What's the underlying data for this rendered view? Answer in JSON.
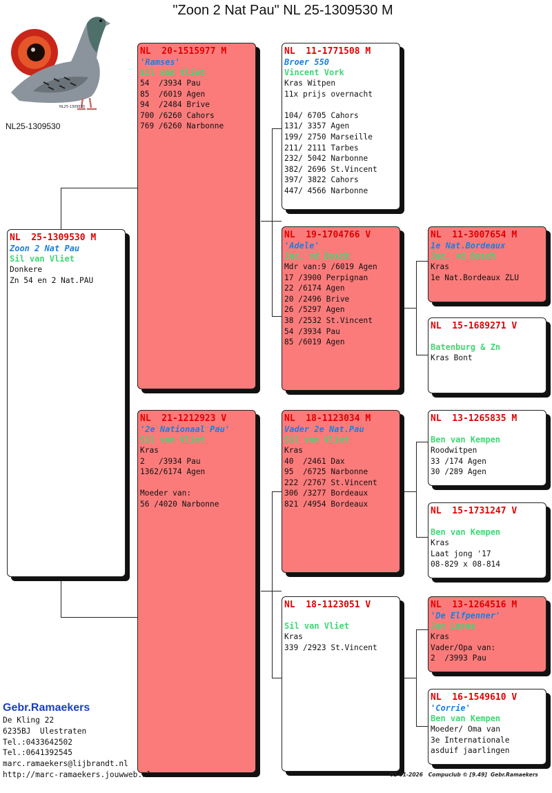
{
  "title": "\"Zoon 2 Nat Pau\"  NL  25-1309530 M",
  "photo": {
    "caption": "NL25-1309530",
    "ring_small": "NL25-1309530"
  },
  "subject": {
    "ring": "NL  25-1309530 M",
    "name": "Zoon 2 Nat Pau",
    "breeder": "Sil van Vliet",
    "lines": [
      "Donkere",
      "Zn 54 en 2 Nat.PAU"
    ]
  },
  "father": {
    "ring": "NL  20-1515977 M",
    "name": "'Ramses'",
    "breeder": "Sil van Vliet",
    "lines": [
      "54  /3934 Pau",
      "85  /6019 Agen",
      "94  /2484 Brive",
      "700 /6260 Cahors",
      "769 /6260 Narbonne"
    ]
  },
  "mother": {
    "ring": "NL  21-1212923 V",
    "name": "'2e Nationaal Pau'",
    "breeder": "Sil van Vliet",
    "lines": [
      "Kras",
      "2   /3934 Pau",
      "1362/6174 Agen",
      "",
      "Moeder van:",
      "56 /4020 Narbonne"
    ]
  },
  "ff": {
    "ring": "NL  11-1771508 M",
    "name": "Broer 550",
    "breeder": "Vincent Vork",
    "lines": [
      "Kras Witpen",
      "11x prijs overnacht",
      "",
      "104/ 6705 Cahors",
      "131/ 3357 Agen",
      "199/ 2750 Marseille",
      "211/ 2111 Tarbes",
      "232/ 5042 Narbonne",
      "382/ 2696 St.Vincent",
      "397/ 3822 Cahors",
      "447/ 4566 Narbonne"
    ]
  },
  "fm": {
    "ring": "NL  19-1704766 V",
    "name": "'Adele'",
    "breeder": "Jac. vd Bosch",
    "lines": [
      "Mdr van:9 /6019 Agen",
      "17 /3900 Perpignan",
      "22 /6174 Agen",
      "20 /2496 Brive",
      "26 /5297 Agen",
      "38 /2532 St.Vincent",
      "54 /3934 Pau",
      "85 /6019 Agen"
    ]
  },
  "mf": {
    "ring": "NL  18-1123034 M",
    "name": "Vader 2e Nat.Pau",
    "breeder": "Sil van Vliet",
    "lines": [
      "Kras",
      "40  /2461 Dax",
      "95  /6725 Narbonne",
      "222 /2767 St.Vincent",
      "306 /3277 Bordeaux",
      "821 /4954 Bordeaux"
    ]
  },
  "mm": {
    "ring": "NL  18-1123051 V",
    "name": "",
    "breeder": "Sil van Vliet",
    "lines": [
      "Kras",
      "339 /2923 St.Vincent"
    ]
  },
  "fmf": {
    "ring": "NL  11-3007654 M",
    "name": "1e Nat.Bordeaux",
    "breeder": "Jac. vd Bosch",
    "lines": [
      "Kras",
      "1e Nat.Bordeaux ZLU"
    ]
  },
  "fmm": {
    "ring": "NL  15-1689271 V",
    "name": "",
    "breeder": "Batenburg & Zn",
    "lines": [
      "Kras Bont"
    ]
  },
  "mff": {
    "ring": "NL  13-1265835 M",
    "name": "",
    "breeder": "Ben van Kempen",
    "lines": [
      "Roodwitpen",
      "33 /174 Agen",
      "30 /289 Agen"
    ]
  },
  "mfm": {
    "ring": "NL  15-1731247 V",
    "name": "",
    "breeder": "Ben van Kempen",
    "lines": [
      "Kras",
      "Laat jong '17",
      "08-829 x 08-814"
    ]
  },
  "mmf": {
    "ring": "NL  13-1264516 M",
    "name": "'De Elfpenner'",
    "breeder": "Jan Lases",
    "lines": [
      "Kras",
      "Vader/Opa van:",
      "2  /3993 Pau"
    ]
  },
  "mmm": {
    "ring": "NL  16-1549610 V",
    "name": "'Corrie'",
    "breeder": "Ben van Kempen",
    "lines": [
      "Moeder/ Oma van",
      "3e Internationale",
      "asduif jaarlingen"
    ]
  },
  "footer": {
    "club": "Gebr.Ramaekers",
    "address": [
      "De Kling 22",
      "6235BJ  Ulestraten",
      "Tel.:0433642502",
      "Tel.:0641392545",
      "marc.ramaekers@lijbrandt.nl",
      "http://marc-ramaekers.jouwweb.nl"
    ],
    "stamp": "01-01-2026   Compuclub © [9.49]  Gebr.Ramaekers"
  },
  "colors": {
    "male_box": "#fb7b7b",
    "female_box": "#ffffff",
    "ring": "#e00000",
    "name": "#1a7fe0",
    "breeder": "#3ed774",
    "club": "#1a3fc4"
  }
}
